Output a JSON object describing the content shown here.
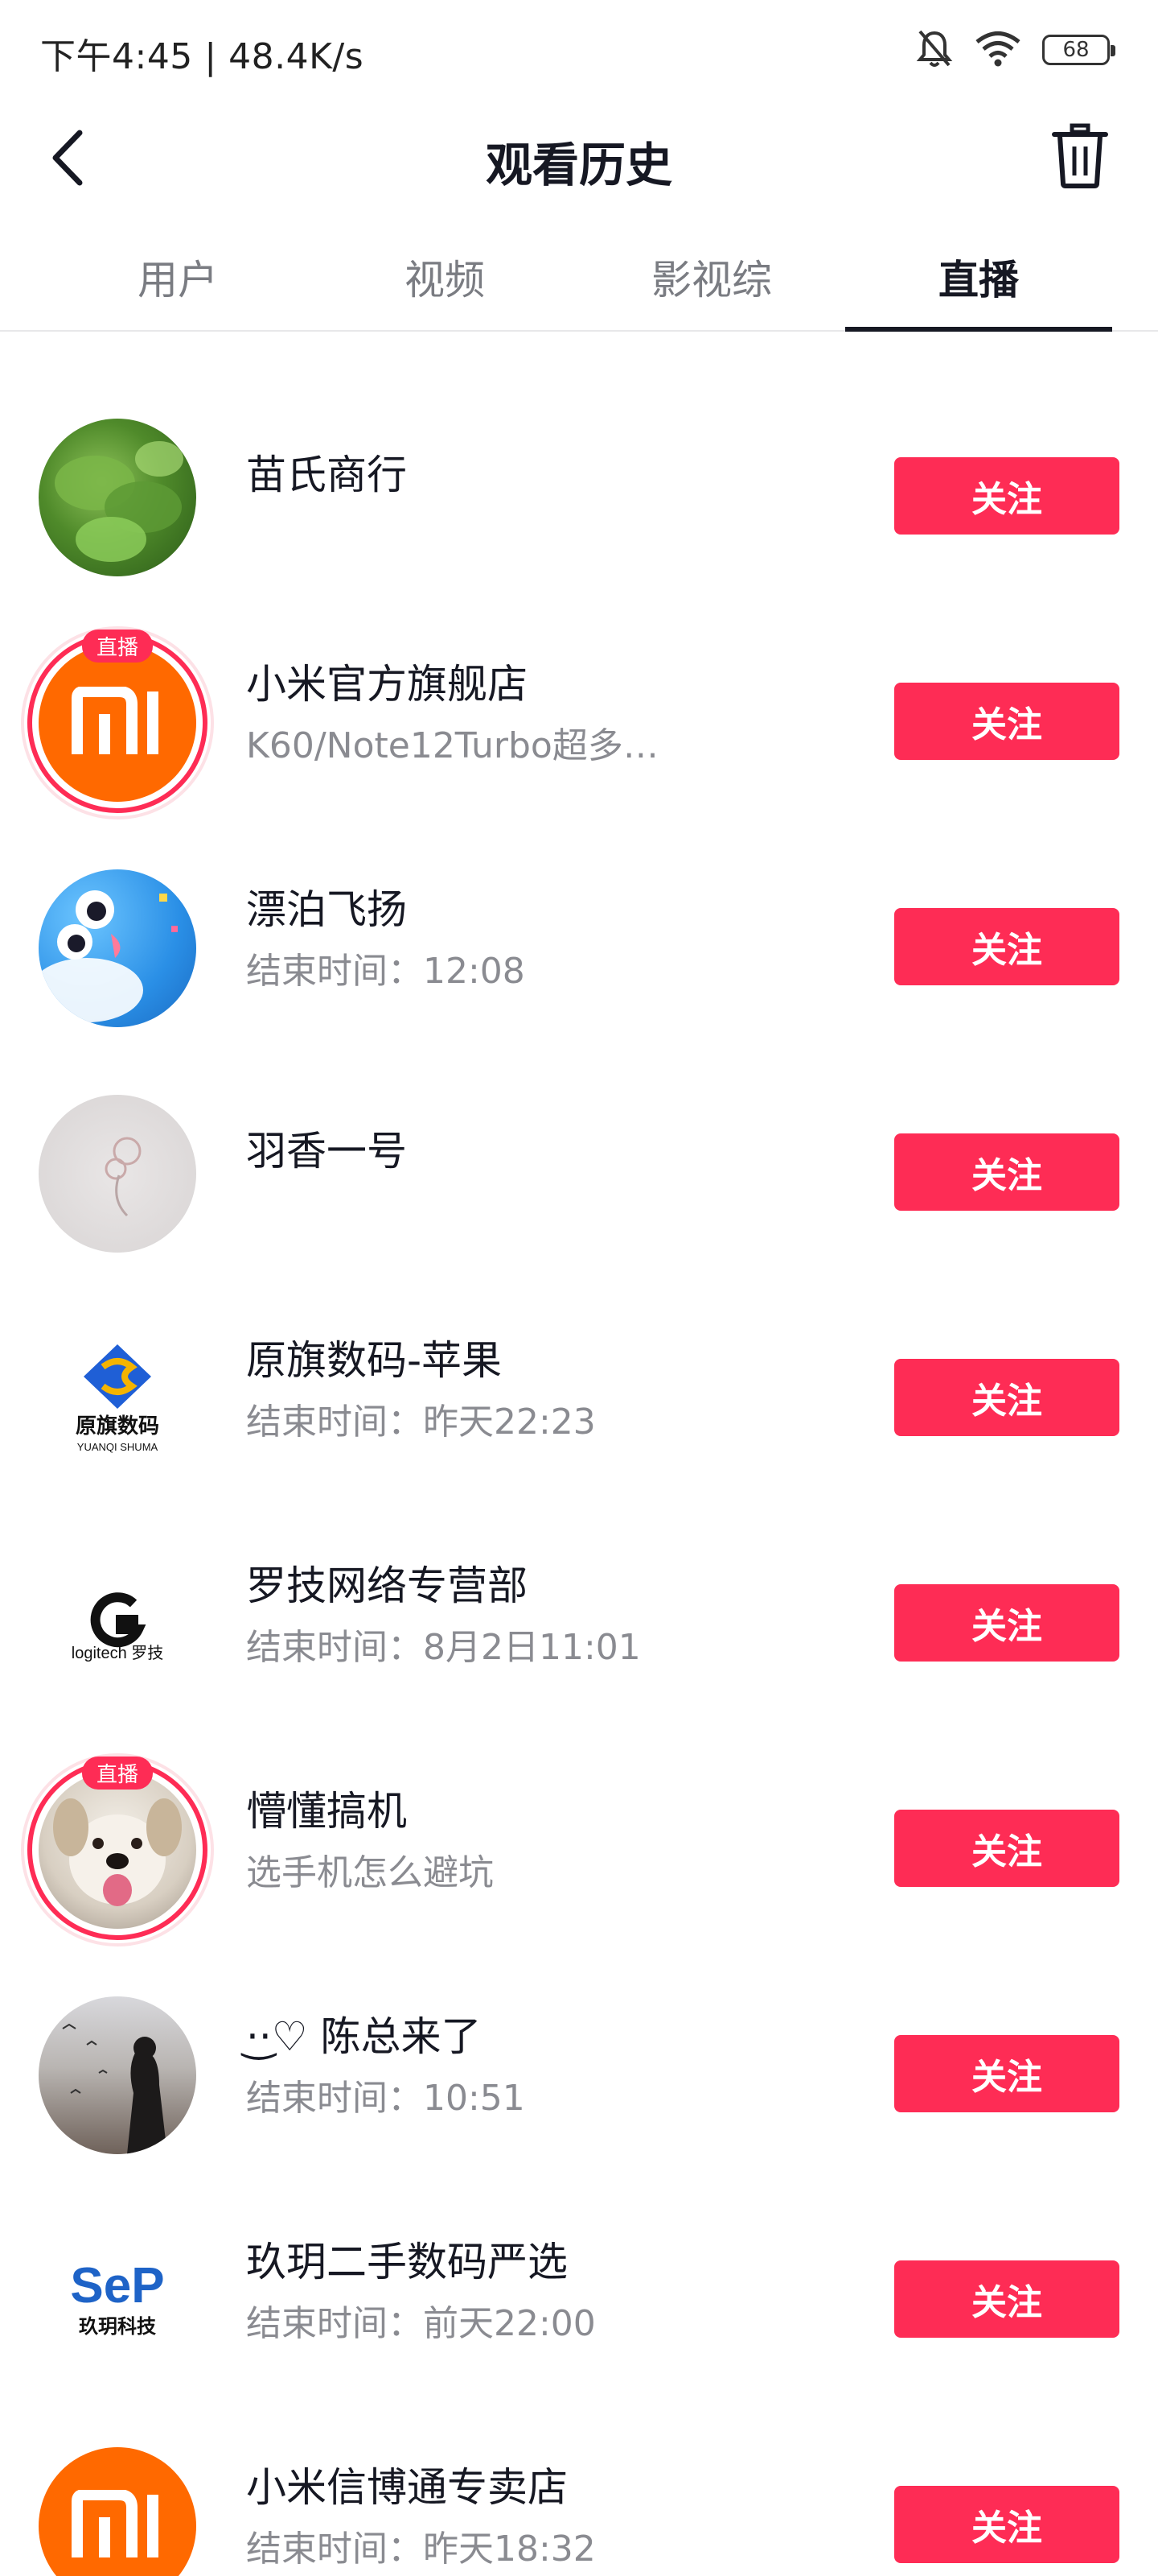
{
  "status_bar": {
    "time_speed": "下午4:45 | 48.4K/s",
    "battery": "68"
  },
  "header": {
    "title": "观看历史"
  },
  "tabs": [
    {
      "label": "用户",
      "active": false
    },
    {
      "label": "视频",
      "active": false
    },
    {
      "label": "影视综",
      "active": false
    },
    {
      "label": "直播",
      "active": true
    }
  ],
  "live_tag": "直播",
  "follow_label": "关注",
  "items": [
    {
      "name": "苗氏商行",
      "sub": "",
      "live": false
    },
    {
      "name": "小米官方旗舰店",
      "sub": "K60/Note12Turbo超多…",
      "live": true
    },
    {
      "name": "漂泊飞扬",
      "sub": "结束时间：12:08",
      "live": false
    },
    {
      "name": "羽香一号",
      "sub": "",
      "live": false
    },
    {
      "name": "原旗数码-苹果",
      "sub": "结束时间：昨天22:23",
      "live": false,
      "logo_text": "原旗数码",
      "logo_sub": "YUANQI SHUMA"
    },
    {
      "name": "罗技网络专营部",
      "sub": "结束时间：8月2日11:01",
      "live": false,
      "logo_text": "logitech 罗技"
    },
    {
      "name": "懵懂搞机",
      "sub": "选手机怎么避坑",
      "live": true
    },
    {
      "name": "·͜·♡ 陈总来了",
      "sub": "结束时间：10:51",
      "live": false
    },
    {
      "name": "玖玥二手数码严选",
      "sub": "结束时间：前天22:00",
      "live": false,
      "logo_text": "SeP",
      "logo_sub": "玖玥科技"
    },
    {
      "name": "小米信博通专卖店",
      "sub": "结束时间：昨天18:32",
      "live": false
    }
  ],
  "colors": {
    "accent": "#fe2c55",
    "text_primary": "#161823",
    "text_secondary": "#8a8b91",
    "mi_orange": "#ff6900"
  }
}
